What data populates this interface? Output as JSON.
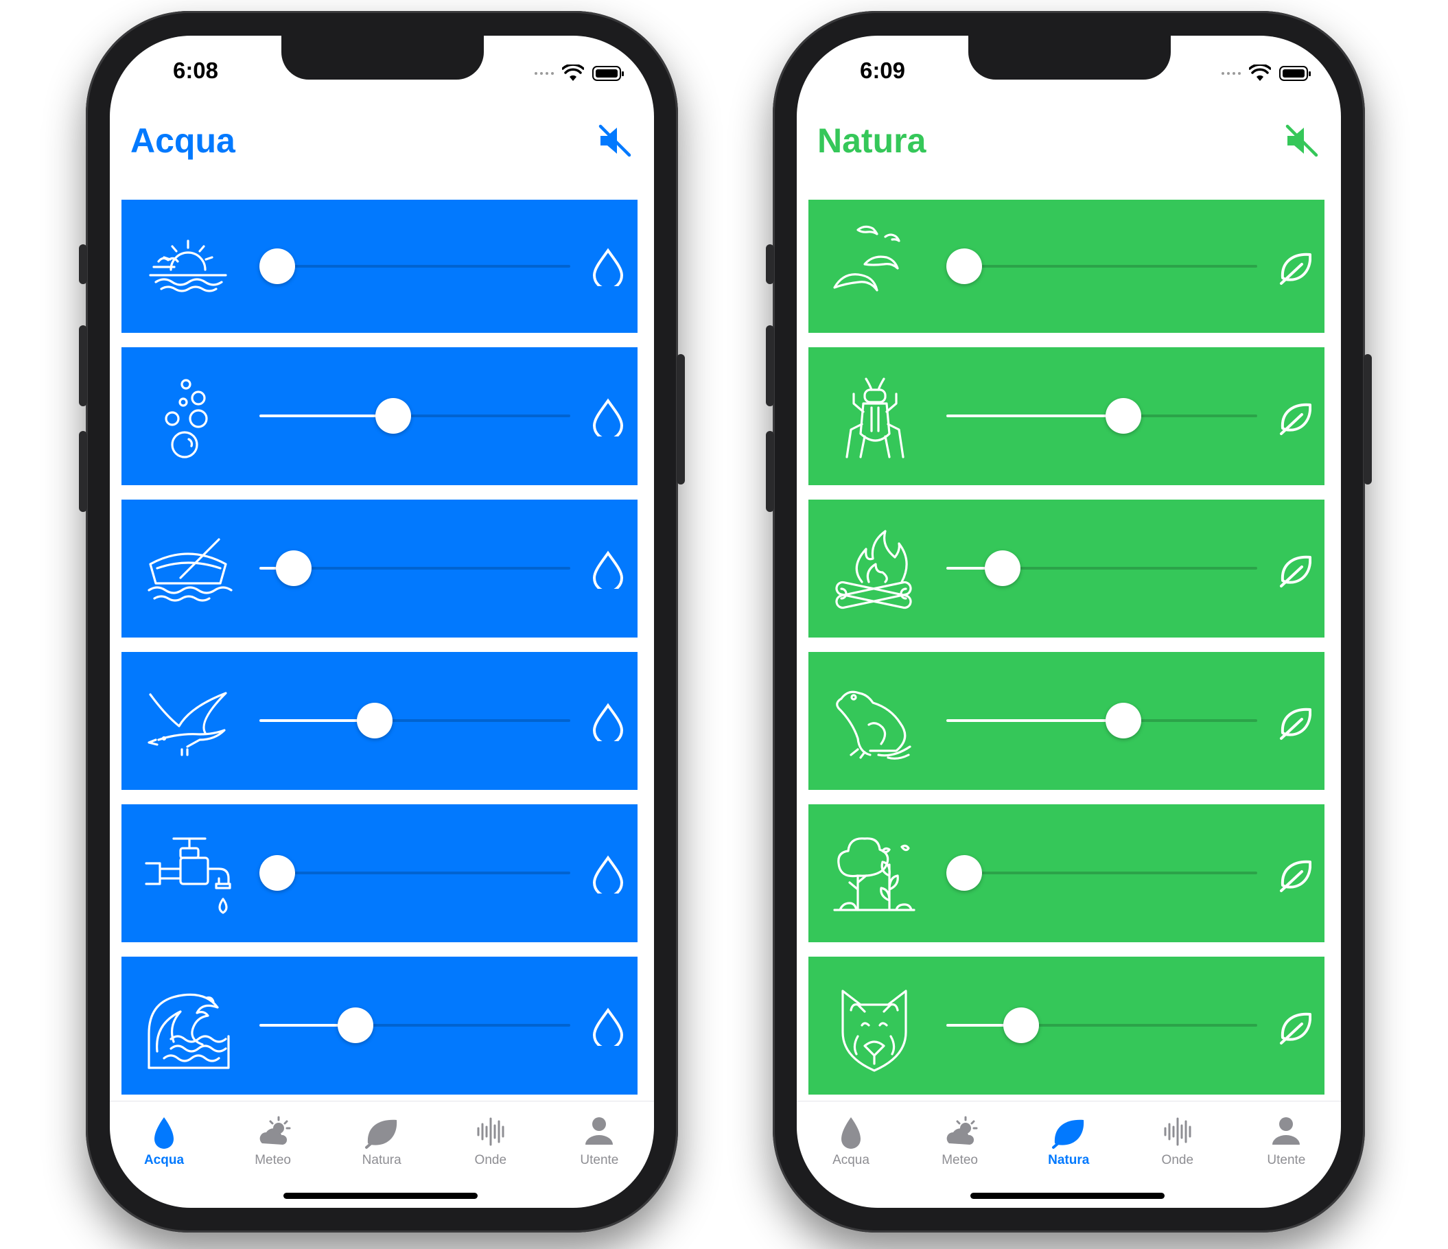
{
  "colors": {
    "acqua": "#0279FE",
    "natura": "#35C759",
    "inactive": "#8e8e93"
  },
  "screens": [
    {
      "time": "6:08",
      "title": "Acqua",
      "accent": "#0279FE",
      "end_icon": "water-drop-icon",
      "rows": [
        {
          "icon": "sunrise-sea-icon",
          "level": 0.0
        },
        {
          "icon": "bubbles-icon",
          "level": 0.43
        },
        {
          "icon": "rowboat-icon",
          "level": 0.11
        },
        {
          "icon": "seagull-icon",
          "level": 0.37
        },
        {
          "icon": "dripping-faucet-icon",
          "level": 0.0
        },
        {
          "icon": "ocean-wave-icon",
          "level": 0.31
        }
      ],
      "active_tab": 0
    },
    {
      "time": "6:09",
      "title": "Natura",
      "accent": "#35C759",
      "end_icon": "leaf-icon",
      "rows": [
        {
          "icon": "birds-icon",
          "level": 0.0
        },
        {
          "icon": "cricket-icon",
          "level": 0.57
        },
        {
          "icon": "campfire-icon",
          "level": 0.18
        },
        {
          "icon": "frog-icon",
          "level": 0.57
        },
        {
          "icon": "forest-icon",
          "level": 0.0
        },
        {
          "icon": "wolf-icon",
          "level": 0.24
        }
      ],
      "active_tab": 2
    }
  ],
  "tabs": [
    {
      "label": "Acqua",
      "icon": "water-drop-icon"
    },
    {
      "label": "Meteo",
      "icon": "partly-sunny-icon"
    },
    {
      "label": "Natura",
      "icon": "leaf-icon"
    },
    {
      "label": "Onde",
      "icon": "waveform-icon"
    },
    {
      "label": "Utente",
      "icon": "person-icon"
    }
  ]
}
